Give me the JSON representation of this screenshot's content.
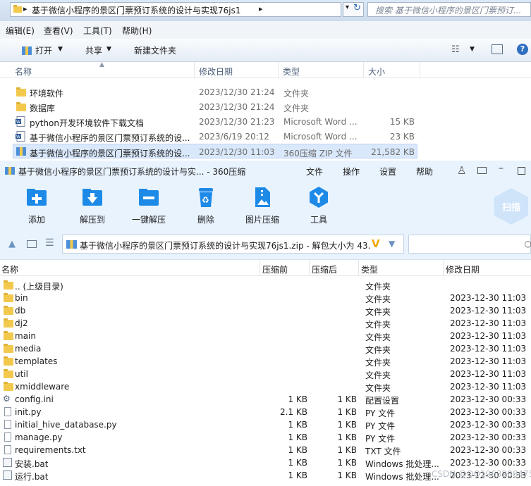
{
  "explorer": {
    "breadcrumb": "基于微信小程序的景区门票预订系统的设计与实现76js1",
    "search_placeholder": "搜索 基于微信小程序的景区门票预订...",
    "menu": [
      "编辑(E)",
      "查看(V)",
      "工具(T)",
      "帮助(H)"
    ],
    "toolbar": {
      "open": "打开",
      "share": "共享",
      "new_folder": "新建文件夹"
    },
    "columns": {
      "name": "名称",
      "date": "修改日期",
      "type": "类型",
      "size": "大小"
    },
    "files": [
      {
        "name": "环境软件",
        "date": "2023/12/30 21:24",
        "type": "文件夹",
        "size": "",
        "icon": "folder-icon"
      },
      {
        "name": "数据库",
        "date": "2023/12/30 21:24",
        "type": "文件夹",
        "size": "",
        "icon": "folder-icon"
      },
      {
        "name": "python开发环境软件下载文档",
        "date": "2023/12/30 21:23",
        "type": "Microsoft Word ...",
        "size": "15 KB",
        "icon": "word-icon"
      },
      {
        "name": "基于微信小程序的景区门票预订系统的设...",
        "date": "2023/6/19 20:12",
        "type": "Microsoft Word ...",
        "size": "23 KB",
        "icon": "word-icon"
      },
      {
        "name": "基于微信小程序的景区门票预订系统的设...",
        "date": "2023/12/30 11:03",
        "type": "360压缩 ZIP 文件",
        "size": "21,582 KB",
        "icon": "zip-icon",
        "selected": true
      }
    ]
  },
  "zip": {
    "title": "基于微信小程序的景区门票预订系统的设计与实... - 360压缩",
    "title_menu": [
      "文件",
      "操作",
      "设置",
      "帮助"
    ],
    "tools": [
      "添加",
      "解压到",
      "一键解压",
      "删除",
      "图片压缩",
      "工具"
    ],
    "scan_label": "扫描",
    "path_text": "基于微信小程序的景区门票预订系统的设计与实现76js1.zip - 解包大小为 43.7",
    "columns": {
      "name": "名称",
      "packed": "压缩前",
      "compressed": "压缩后",
      "type": "类型",
      "date": "修改日期"
    },
    "files": [
      {
        "name": ".. (上级目录)",
        "packed": "",
        "compressed": "",
        "type": "文件夹",
        "date": "",
        "icon": "folder-icon"
      },
      {
        "name": "bin",
        "packed": "",
        "compressed": "",
        "type": "文件夹",
        "date": "2023-12-30 11:03",
        "icon": "folder-icon"
      },
      {
        "name": "db",
        "packed": "",
        "compressed": "",
        "type": "文件夹",
        "date": "2023-12-30 11:03",
        "icon": "folder-icon"
      },
      {
        "name": "dj2",
        "packed": "",
        "compressed": "",
        "type": "文件夹",
        "date": "2023-12-30 11:03",
        "icon": "folder-icon"
      },
      {
        "name": "main",
        "packed": "",
        "compressed": "",
        "type": "文件夹",
        "date": "2023-12-30 11:03",
        "icon": "folder-icon"
      },
      {
        "name": "media",
        "packed": "",
        "compressed": "",
        "type": "文件夹",
        "date": "2023-12-30 11:03",
        "icon": "folder-icon"
      },
      {
        "name": "templates",
        "packed": "",
        "compressed": "",
        "type": "文件夹",
        "date": "2023-12-30 11:03",
        "icon": "folder-icon"
      },
      {
        "name": "util",
        "packed": "",
        "compressed": "",
        "type": "文件夹",
        "date": "2023-12-30 11:03",
        "icon": "folder-icon"
      },
      {
        "name": "xmiddleware",
        "packed": "",
        "compressed": "",
        "type": "文件夹",
        "date": "2023-12-30 11:03",
        "icon": "folder-icon"
      },
      {
        "name": "config.ini",
        "packed": "1 KB",
        "compressed": "1 KB",
        "type": "配置设置",
        "date": "2023-12-30 00:33",
        "icon": "config-file-icon"
      },
      {
        "name": "init.py",
        "packed": "2.1 KB",
        "compressed": "1 KB",
        "type": "PY 文件",
        "date": "2023-12-30 00:33",
        "icon": "file-icon"
      },
      {
        "name": "initial_hive_database.py",
        "packed": "1 KB",
        "compressed": "1 KB",
        "type": "PY 文件",
        "date": "2023-12-30 00:33",
        "icon": "file-icon"
      },
      {
        "name": "manage.py",
        "packed": "1 KB",
        "compressed": "1 KB",
        "type": "PY 文件",
        "date": "2023-12-30 00:33",
        "icon": "file-icon"
      },
      {
        "name": "requirements.txt",
        "packed": "1 KB",
        "compressed": "1 KB",
        "type": "TXT 文件",
        "date": "2023-12-30 00:33",
        "icon": "file-icon"
      },
      {
        "name": "安装.bat",
        "packed": "1 KB",
        "compressed": "1 KB",
        "type": "Windows 批处理...",
        "date": "2023-12-30 00:33",
        "icon": "bat-file-icon"
      },
      {
        "name": "运行.bat",
        "packed": "1 KB",
        "compressed": "1 KB",
        "type": "Windows 批处理...",
        "date": "2023-12-30 00:33",
        "icon": "bat-file-icon"
      }
    ],
    "watermark": "CSDN @QQ1963288475"
  },
  "colors": {
    "accent": "#1e8ae8",
    "folder": "#f2c94c",
    "zip_bg": "#e8f3fe",
    "selection": "#d9e8fb"
  }
}
